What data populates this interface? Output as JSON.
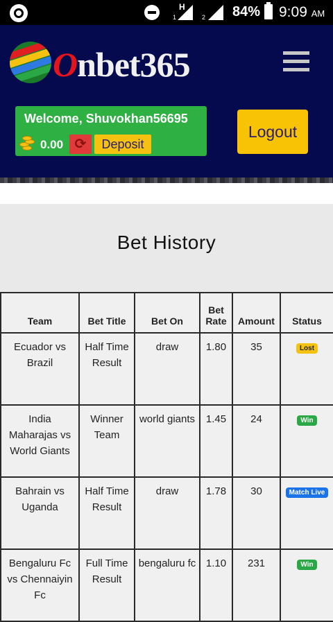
{
  "status_bar": {
    "battery": "84%",
    "time": "9:09",
    "ampm": "AM",
    "signal_h": "H",
    "sim1": "1",
    "sim2": "2"
  },
  "header": {
    "logo_text": "Onbet365",
    "logo_first": "O",
    "logo_rest": "nbet365",
    "welcome": "Welcome, Shuvokhan56695",
    "balance": "0.00",
    "refresh_icon": "⟳",
    "deposit_label": "Deposit",
    "logout_label": "Logout"
  },
  "page": {
    "title": "Bet History"
  },
  "table": {
    "headers": {
      "team": "Team",
      "bet_title": "Bet Title",
      "bet_on": "Bet On",
      "bet_rate": "Bet Rate",
      "amount": "Amount",
      "status": "Status"
    },
    "rows": [
      {
        "team": "Ecuador vs Brazil",
        "bet_title": "Half Time Result",
        "bet_on": "draw",
        "bet_rate": "1.80",
        "amount": "35",
        "status": "Lost"
      },
      {
        "team": "India Maharajas vs World Giants",
        "bet_title": "Winner Team",
        "bet_on": "world giants",
        "bet_rate": "1.45",
        "amount": "24",
        "status": "Win"
      },
      {
        "team": "Bahrain vs Uganda",
        "bet_title": "Half Time Result",
        "bet_on": "draw",
        "bet_rate": "1.78",
        "amount": "30",
        "status": "Match Live"
      },
      {
        "team": "Bengaluru Fc vs Chennaiyin Fc",
        "bet_title": "Full Time Result",
        "bet_on": "bengaluru fc",
        "bet_rate": "1.10",
        "amount": "231",
        "status": "Win"
      }
    ]
  },
  "colors": {
    "header_bg": "#040a4d",
    "welcome_bg": "#2fb043",
    "logout_bg": "#f9c305",
    "lost": "#f5c211",
    "win": "#2aa845",
    "live": "#1a73e8"
  }
}
